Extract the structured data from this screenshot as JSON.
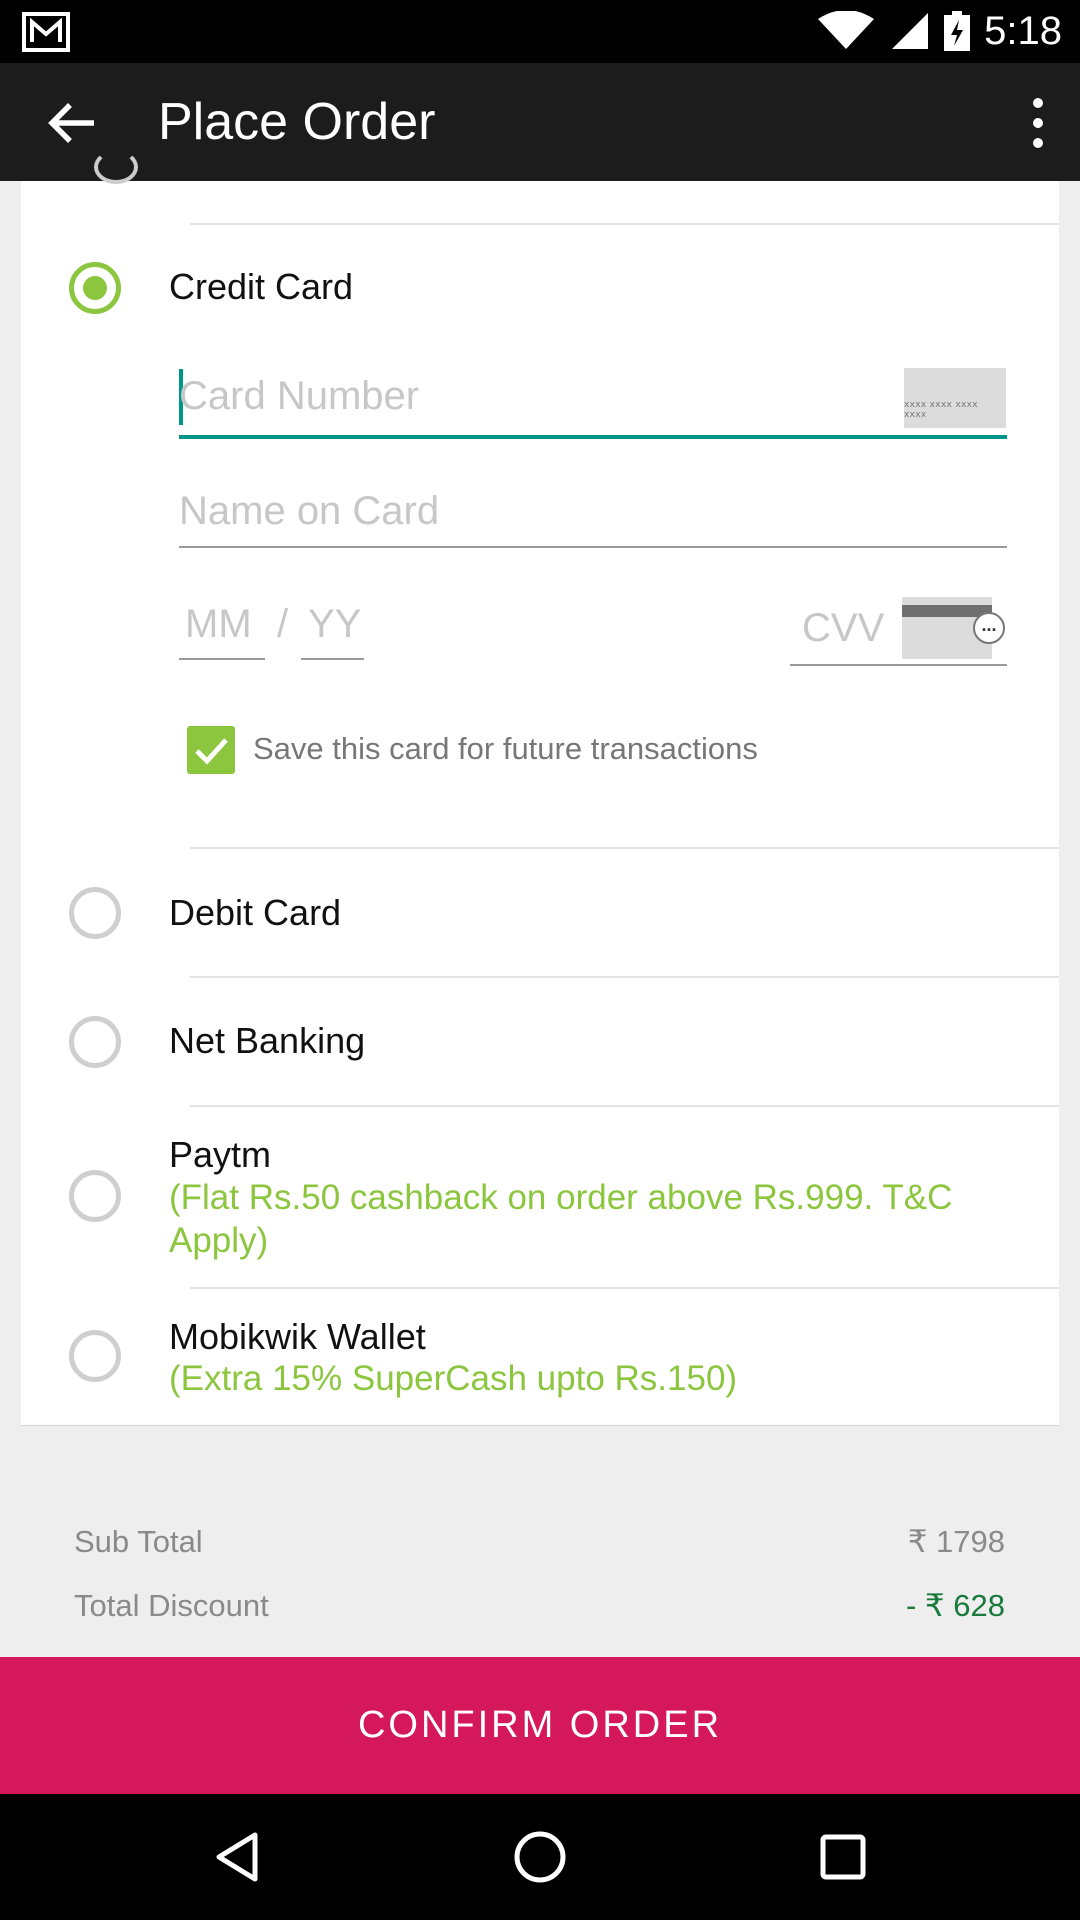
{
  "status_bar": {
    "time": "5:18",
    "icons": [
      "gmail-icon",
      "wifi-icon",
      "signal-icon",
      "battery-charging-icon"
    ]
  },
  "app_bar": {
    "title": "Place Order",
    "icons": [
      "back-arrow-icon",
      "overflow-menu-icon"
    ]
  },
  "payment_options": [
    {
      "label": "Credit Card",
      "selected": true
    },
    {
      "label": "Debit Card",
      "selected": false
    },
    {
      "label": "Net Banking",
      "selected": false
    },
    {
      "label": "Paytm",
      "note": "(Flat Rs.50 cashback on order above Rs.999. T&C Apply)",
      "selected": false
    },
    {
      "label": "Mobikwik Wallet",
      "note": "(Extra 15% SuperCash upto Rs.150)",
      "selected": false
    }
  ],
  "credit_card_form": {
    "card_number_placeholder": "Card Number",
    "card_thumb_text": "xxxx xxxx xxxx xxxx",
    "name_placeholder": "Name on Card",
    "month_placeholder": "MM",
    "separator": "/",
    "year_placeholder": "YY",
    "cvv_placeholder": "CVV",
    "cvv_hint": "...",
    "save_card_label": "Save this card for future transactions",
    "save_card_checked": true
  },
  "summary": {
    "sub_total_label": "Sub Total",
    "sub_total_value": "₹ 1798",
    "discount_label": "Total Discount",
    "discount_value": "- ₹ 628"
  },
  "confirm_button": {
    "label": "CONFIRM ORDER"
  },
  "colors": {
    "accent_green": "#8cc63f",
    "focus_teal": "#009688",
    "confirm_pink": "#d4185a",
    "app_bar": "#1c1c1c"
  },
  "nav_bar": {
    "icons": [
      "back-triangle-icon",
      "home-circle-icon",
      "recents-square-icon"
    ]
  }
}
